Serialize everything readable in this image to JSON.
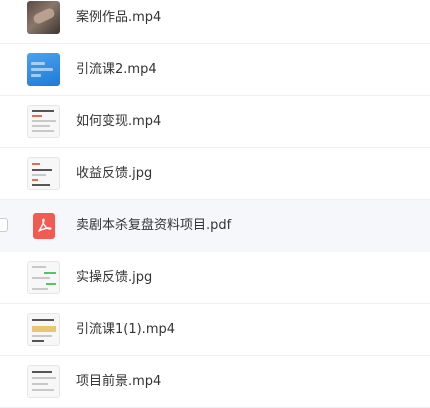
{
  "files": [
    {
      "name": "案例作品.mp4",
      "thumb": "video-photo-thumbnail"
    },
    {
      "name": "引流课2.mp4",
      "thumb": "video-blue-thumbnail"
    },
    {
      "name": "如何变现.mp4",
      "thumb": "document-thumbnail"
    },
    {
      "name": "收益反馈.jpg",
      "thumb": "image-thumbnail"
    },
    {
      "name": "卖剧本杀复盘资料项目.pdf",
      "thumb": "pdf-icon"
    },
    {
      "name": "实操反馈.jpg",
      "thumb": "chat-screenshot-thumbnail"
    },
    {
      "name": "引流课1(1).mp4",
      "thumb": "video-slide-thumbnail"
    },
    {
      "name": "项目前景.mp4",
      "thumb": "document-thumbnail"
    }
  ],
  "colors": {
    "pdf": "#f15b52",
    "hover_row": "#f5f7fa",
    "divider": "#eef0f3",
    "text": "#333333"
  }
}
